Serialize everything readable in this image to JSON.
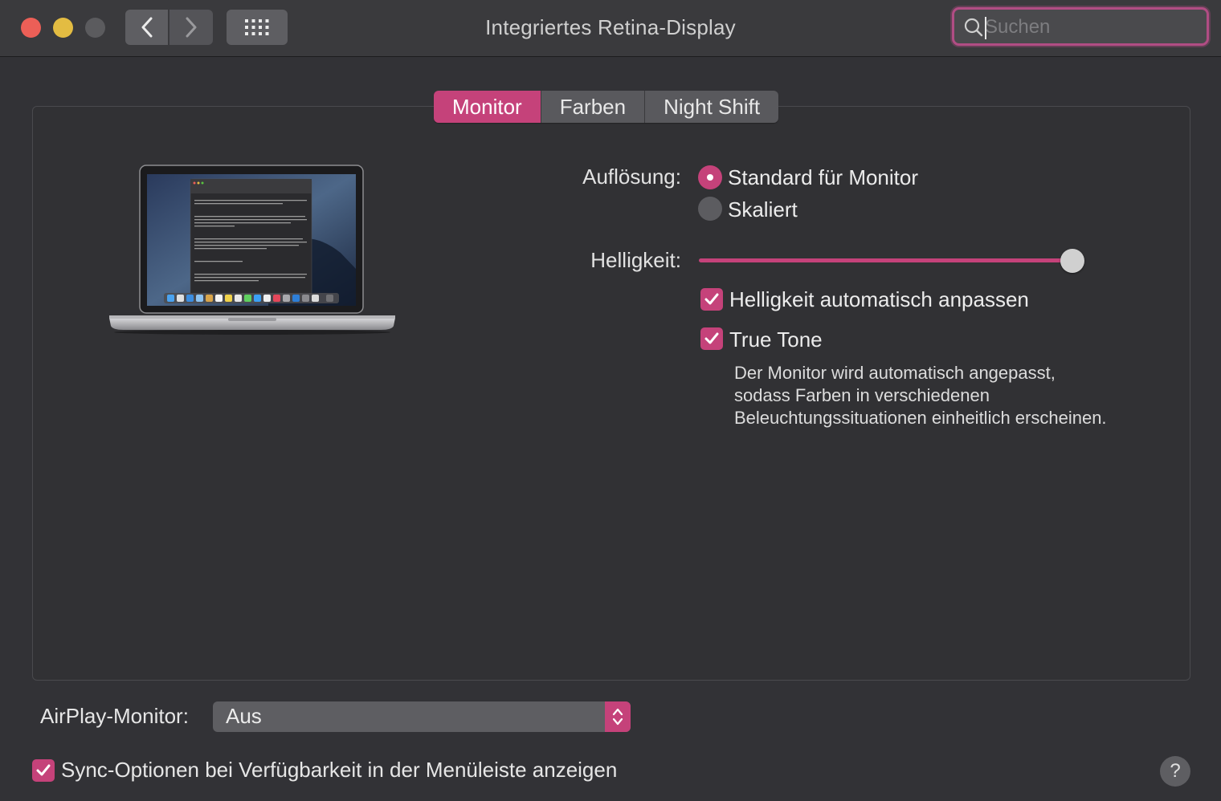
{
  "window": {
    "title": "Integriertes Retina-Display"
  },
  "search": {
    "placeholder": "Suchen"
  },
  "tabs": [
    {
      "label": "Monitor",
      "active": true
    },
    {
      "label": "Farben",
      "active": false
    },
    {
      "label": "Night Shift",
      "active": false
    }
  ],
  "resolution": {
    "label": "Auflösung:",
    "options": [
      {
        "label": "Standard für Monitor",
        "selected": true
      },
      {
        "label": "Skaliert",
        "selected": false
      }
    ]
  },
  "brightness": {
    "label": "Helligkeit:",
    "value": 1.0
  },
  "checkboxes": {
    "auto_brightness": {
      "label": "Helligkeit automatisch anpassen",
      "checked": true
    },
    "true_tone": {
      "label": "True Tone",
      "checked": true
    }
  },
  "true_tone_description": {
    "line1": "Der Monitor wird automatisch angepasst,",
    "line2": "sodass Farben in verschiedenen",
    "line3": "Beleuchtungssituationen einheitlich erscheinen."
  },
  "airplay": {
    "label": "AirPlay-Monitor:",
    "value": "Aus"
  },
  "sync": {
    "label": "Sync-Optionen bei Verfügbarkeit in der Menüleiste anzeigen",
    "checked": true
  },
  "help": {
    "label": "?"
  },
  "colors": {
    "accent": "#c5427a",
    "background": "#323236"
  }
}
